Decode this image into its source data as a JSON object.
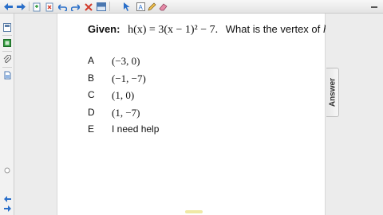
{
  "toolbar": {
    "buttons": [
      "back-icon",
      "forward-icon",
      "page-add-icon",
      "page-delete-icon",
      "undo-icon",
      "redo-icon",
      "delete-icon",
      "screen-shade-icon",
      "select-icon",
      "text-icon",
      "pen-icon",
      "eraser-icon"
    ]
  },
  "sidebar": {
    "buttons": [
      "page-sorter-icon",
      "gallery-icon",
      "attachments-icon",
      "properties-icon"
    ]
  },
  "question": {
    "label": "Given:",
    "expression": "h(x) = 3(x − 1)² − 7.",
    "prompt": "What is the vertex of",
    "variable": "h",
    "suffix": "?"
  },
  "choices": [
    {
      "letter": "A",
      "text": "(−3, 0)",
      "math": true
    },
    {
      "letter": "B",
      "text": "(−1, −7)",
      "math": true
    },
    {
      "letter": "C",
      "text": "(1, 0)",
      "math": true
    },
    {
      "letter": "D",
      "text": "(1, −7)",
      "math": true
    },
    {
      "letter": "E",
      "text": "I need help",
      "math": false
    }
  ],
  "answer_tab": {
    "label": "Answer"
  },
  "colors": {
    "accent_blue": "#2a6fc9",
    "toolbar_red": "#d23b2b",
    "toolbar_green": "#2e9a3a"
  }
}
